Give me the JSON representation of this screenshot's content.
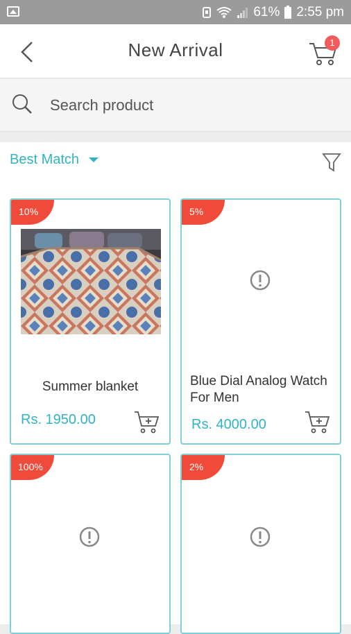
{
  "status_bar": {
    "battery": "61%",
    "time": "2:55 pm"
  },
  "header": {
    "title": "New Arrival",
    "cart_count": "1"
  },
  "search": {
    "placeholder": "Search product"
  },
  "sort": {
    "selected": "Best Match"
  },
  "colors": {
    "accent": "#2fb4c4",
    "discount_badge": "#f04b3a",
    "card_border": "#7fcfd6",
    "status_bar": "#9b9b9b"
  },
  "products": [
    {
      "discount": "10%",
      "name": "Summer blanket",
      "price": "Rs. 1950.00",
      "image": "blanket-photo"
    },
    {
      "discount": "5%",
      "name": "Blue Dial Analog Watch For Men",
      "price": "Rs. 4000.00",
      "image": "missing-image-icon"
    },
    {
      "discount": "100%",
      "name": "",
      "price": "",
      "image": "missing-image-icon"
    },
    {
      "discount": "2%",
      "name": "",
      "price": "",
      "image": "missing-image-icon"
    }
  ]
}
